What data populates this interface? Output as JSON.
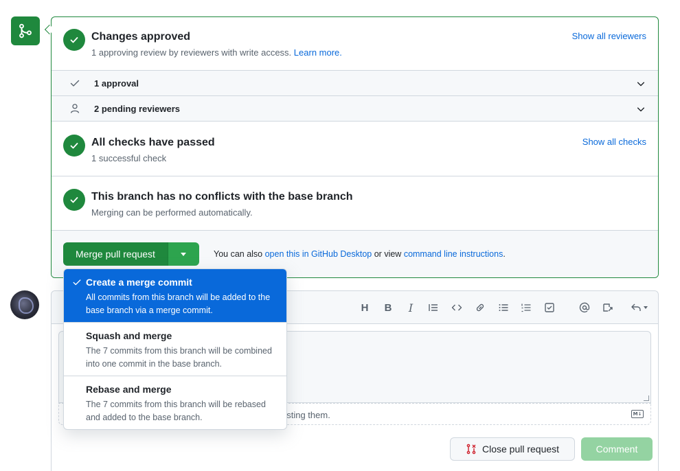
{
  "status": {
    "approved_title": "Changes approved",
    "approved_sub": "1 approving review by reviewers with write access.",
    "learn_more": "Learn more.",
    "show_reviewers": "Show all reviewers",
    "approvals_label": "1 approval",
    "pending_label": "2 pending reviewers",
    "checks_title": "All checks have passed",
    "checks_sub": "1 successful check",
    "show_checks": "Show all checks",
    "conflicts_title": "This branch has no conflicts with the base branch",
    "conflicts_sub": "Merging can be performed automatically."
  },
  "merge": {
    "button_label": "Merge pull request",
    "also_prefix": "You can also",
    "desktop_link": "open this in GitHub Desktop",
    "or_view": "or view",
    "cli_link": "command line instructions",
    "period": "."
  },
  "merge_options": [
    {
      "title": "Create a merge commit",
      "description": "All commits from this branch will be added to the base branch via a merge commit.",
      "selected": true
    },
    {
      "title": "Squash and merge",
      "description": "The 7 commits from this branch will be combined into one commit in the base branch.",
      "selected": false
    },
    {
      "title": "Rebase and merge",
      "description": "The 7 commits from this branch will be rebased and added to the base branch.",
      "selected": false
    }
  ],
  "toolbar": {
    "heading": "H",
    "bold": "B",
    "italic": "I"
  },
  "comment": {
    "attach_partial": "asting them.",
    "markdown_badge": "M↓",
    "close_pr": "Close pull request",
    "comment": "Comment"
  },
  "colors": {
    "success": "#1f883d",
    "link": "#0969da",
    "selected": "#0969da"
  }
}
